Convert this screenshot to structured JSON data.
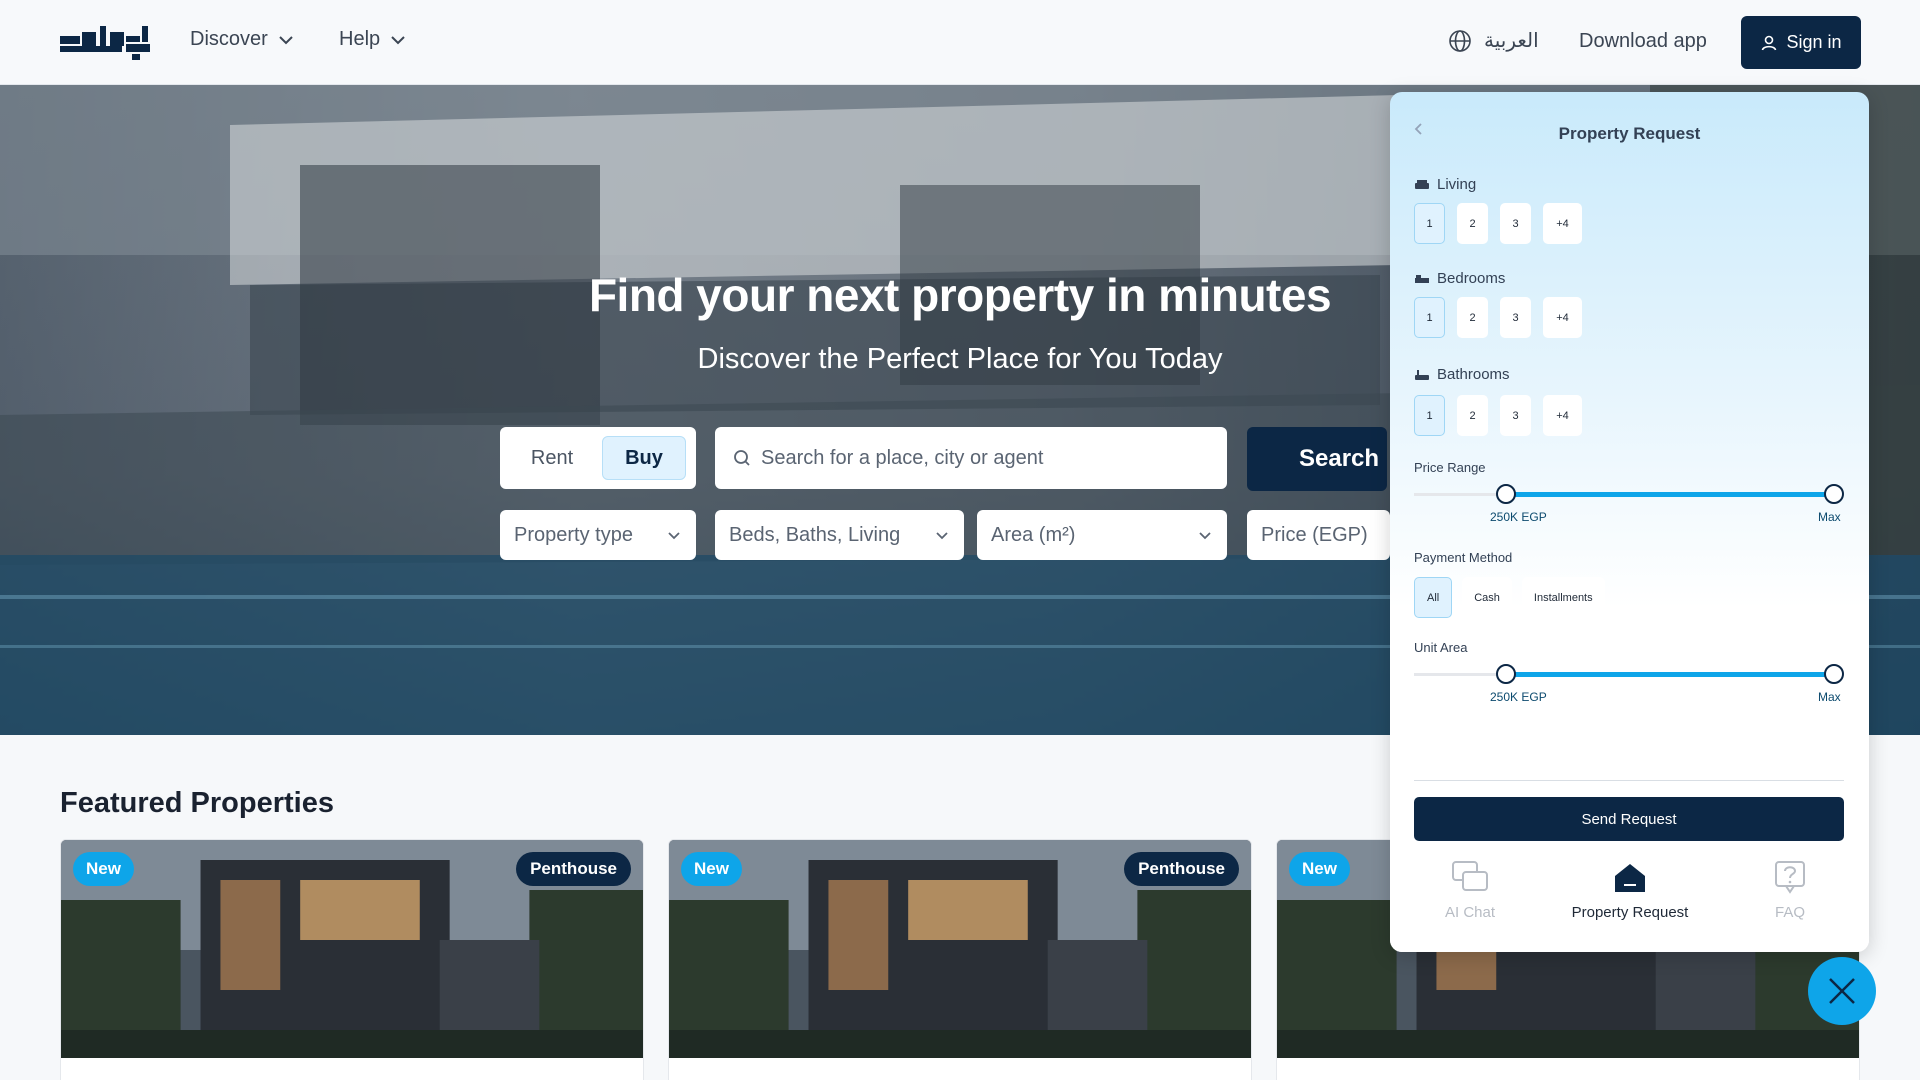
{
  "header": {
    "nav": [
      {
        "label": "Discover"
      },
      {
        "label": "Help"
      }
    ],
    "language": "العربية",
    "download": "Download app",
    "sign_in": "Sign in"
  },
  "hero": {
    "title": "Find your next property in minutes",
    "subtitle": "Discover the Perfect Place for You Today",
    "toggle": {
      "rent": "Rent",
      "buy": "Buy",
      "selected": "Buy"
    },
    "search_placeholder": "Search for a place, city or agent",
    "search_button": "Search",
    "filters": {
      "property_type": "Property type",
      "beds_baths": "Beds, Baths, Living",
      "area": "Area (m²)",
      "price": "Price (EGP)"
    }
  },
  "featured": {
    "title": "Featured Properties",
    "cards": [
      {
        "badge": "New",
        "type": "Penthouse"
      },
      {
        "badge": "New",
        "type": "Penthouse"
      },
      {
        "badge": "New"
      }
    ]
  },
  "panel": {
    "title": "Property Request",
    "living": {
      "label": "Living",
      "options": [
        "1",
        "2",
        "3",
        "+4"
      ],
      "selected": "1"
    },
    "bedrooms": {
      "label": "Bedrooms",
      "options": [
        "1",
        "2",
        "3",
        "+4"
      ],
      "selected": "1"
    },
    "bathrooms": {
      "label": "Bathrooms",
      "options": [
        "1",
        "2",
        "3",
        "+4"
      ],
      "selected": "1"
    },
    "price_range": {
      "label": "Price Range",
      "min_label": "250K EGP",
      "max_label": "Max",
      "min_fraction": 0.2,
      "max_fraction": 1.0
    },
    "payment": {
      "label": "Payment Method",
      "options": [
        "All",
        "Cash",
        "Installments"
      ],
      "selected": "All"
    },
    "unit_area": {
      "label": "Unit Area",
      "min_label": "250K EGP",
      "max_label": "Max",
      "min_fraction": 0.2,
      "max_fraction": 1.0
    },
    "send": "Send Request",
    "tabs": [
      {
        "label": "AI Chat",
        "icon": "chat-icon"
      },
      {
        "label": "Property Request",
        "icon": "home-icon"
      },
      {
        "label": "FAQ",
        "icon": "faq-icon"
      }
    ],
    "active_tab": "Property Request"
  },
  "colors": {
    "navy": "#0c2745",
    "accent": "#0ea5e9"
  }
}
